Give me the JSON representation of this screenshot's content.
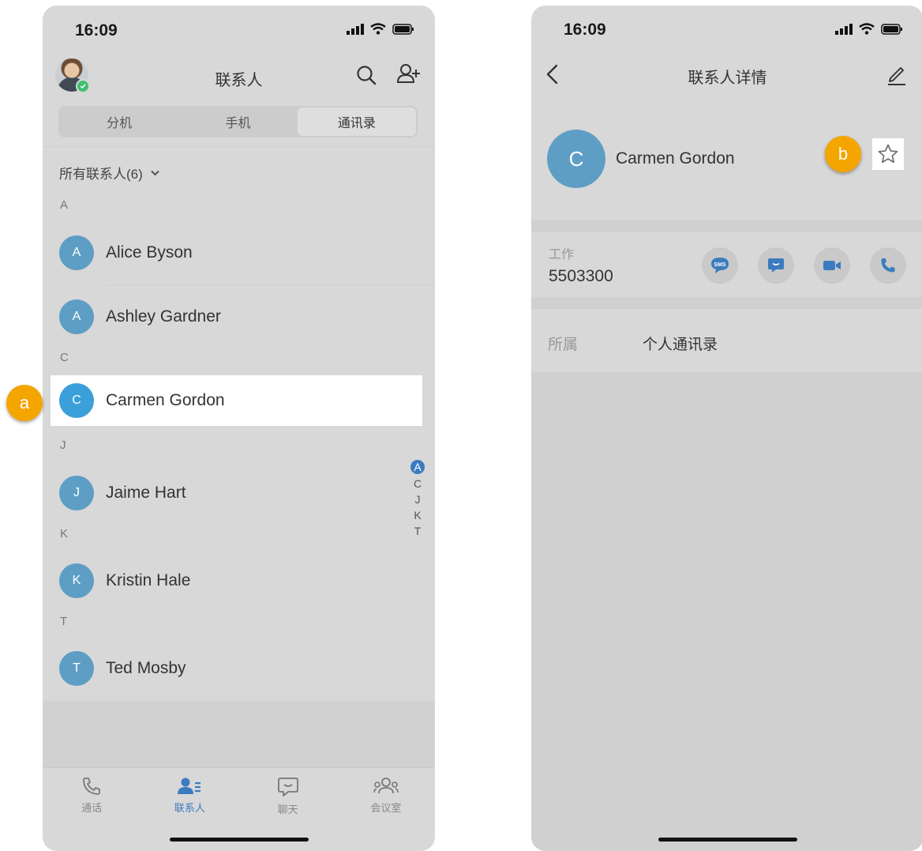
{
  "colors": {
    "accent": "#3b7bbf",
    "avatar": "#5e9ec5",
    "selected_avatar": "#3b9fda",
    "callout": "#f5a500",
    "background": "#d8d8d8"
  },
  "left_screen": {
    "status_time": "16:09",
    "nav_title": "联系人",
    "segments": [
      "分机",
      "手机",
      "通讯录"
    ],
    "active_segment": 2,
    "filter_label": "所有联系人(6)",
    "sections": [
      {
        "letter": "A",
        "contacts": [
          {
            "initial": "A",
            "name": "Alice Byson"
          },
          {
            "initial": "A",
            "name": "Ashley Gardner"
          }
        ]
      },
      {
        "letter": "C",
        "contacts": [
          {
            "initial": "C",
            "name": "Carmen Gordon",
            "selected": true
          }
        ]
      },
      {
        "letter": "J",
        "contacts": [
          {
            "initial": "J",
            "name": "Jaime Hart"
          }
        ]
      },
      {
        "letter": "K",
        "contacts": [
          {
            "initial": "K",
            "name": "Kristin Hale"
          }
        ]
      },
      {
        "letter": "T",
        "contacts": [
          {
            "initial": "T",
            "name": "Ted Mosby"
          }
        ]
      }
    ],
    "alpha_index": [
      "A",
      "C",
      "J",
      "K",
      "T"
    ],
    "tabs": [
      {
        "label": "通话",
        "icon": "phone-icon"
      },
      {
        "label": "联系人",
        "icon": "contacts-icon",
        "active": true
      },
      {
        "label": "聊天",
        "icon": "chat-icon"
      },
      {
        "label": "会议室",
        "icon": "meeting-room-icon"
      }
    ],
    "callout": "a"
  },
  "right_screen": {
    "status_time": "16:09",
    "nav_title": "联系人详情",
    "contact_initial": "C",
    "contact_name": "Carmen Gordon",
    "work_label": "工作",
    "work_number": "5503300",
    "sms_icon_text": "SMS",
    "owner_label": "所属",
    "owner_value": "个人通讯录",
    "callout": "b"
  }
}
